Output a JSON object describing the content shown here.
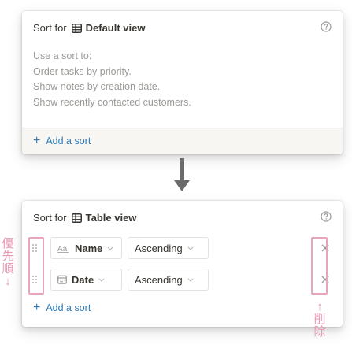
{
  "panel_default": {
    "sort_for": "Sort for",
    "view_name": "Default view",
    "hint_lines": [
      "Use a sort to:",
      "Order tasks by priority.",
      "Show notes by creation date.",
      "Show recently contacted customers."
    ],
    "add_sort": "Add a sort"
  },
  "panel_table": {
    "sort_for": "Sort for",
    "view_name": "Table view",
    "sorts": [
      {
        "property": "Name",
        "property_icon": "text-property-icon",
        "direction": "Ascending"
      },
      {
        "property": "Date",
        "property_icon": "date-property-icon",
        "direction": "Ascending"
      }
    ],
    "add_sort": "Add a sort"
  },
  "annotations": {
    "priority_chars": [
      "優",
      "先",
      "順",
      "↓"
    ],
    "delete_chars": [
      "↑",
      "削",
      "除"
    ]
  },
  "colors": {
    "accent_link": "#2e7bb8",
    "annotation_pink": "#e996b3",
    "highlight_border": "#e8a6bb",
    "muted_text": "#9b9a97",
    "arrow": "#6b6b6b"
  }
}
